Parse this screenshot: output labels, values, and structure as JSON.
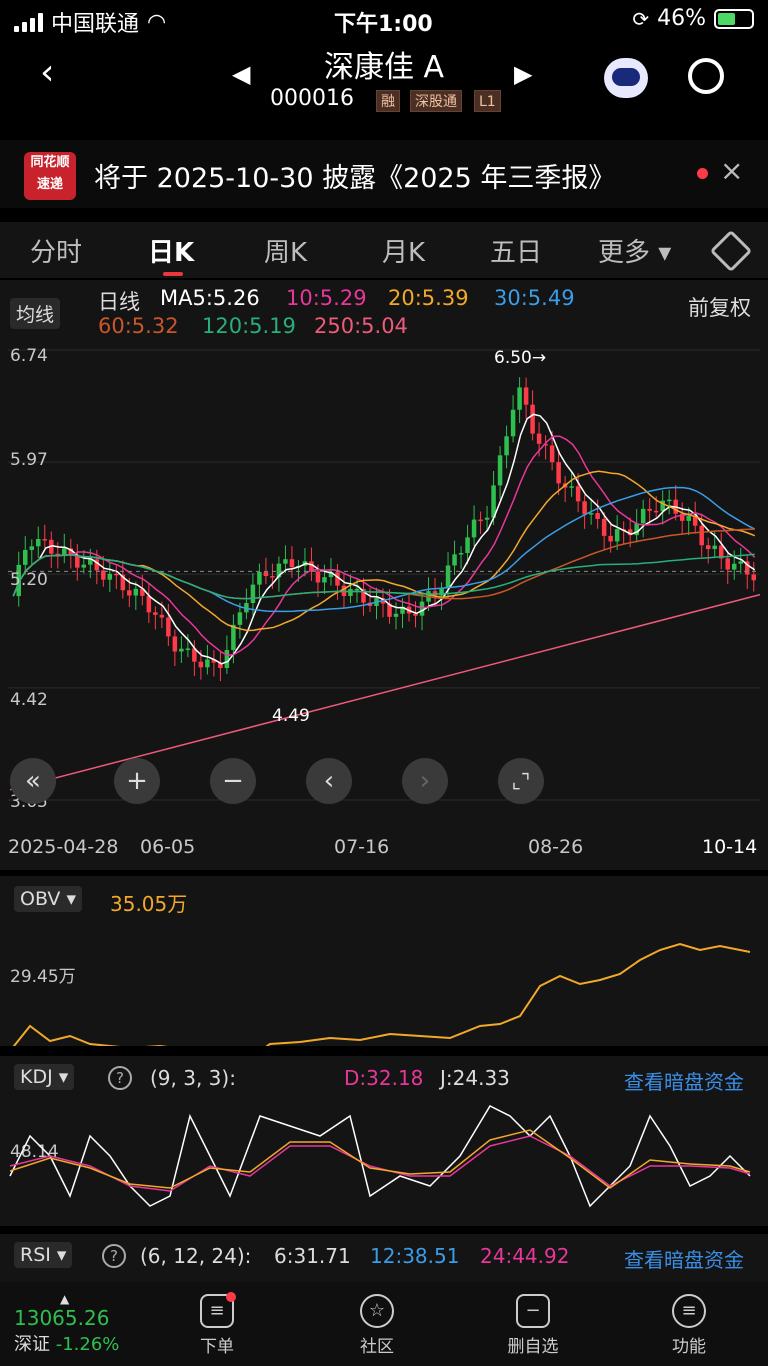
{
  "status_bar": {
    "carrier": "中国联通",
    "time": "下午1:00",
    "battery": "46%"
  },
  "header": {
    "title": "深康佳 A",
    "code": "000016",
    "tags": [
      "融",
      "深股通",
      "L1"
    ]
  },
  "banner": {
    "logo_line1": "同花顺",
    "logo_line2": "速递",
    "text": "将于 2025-10-30 披露《2025 年三季报》"
  },
  "tabs": [
    "分时",
    "日K",
    "周K",
    "月K",
    "五日",
    "更多"
  ],
  "ma_bar": {
    "chip": "均线",
    "kind": "日线",
    "fq": "前复权",
    "items": [
      {
        "label": "MA5:5.26",
        "color": "#ffffff"
      },
      {
        "label": "10:5.29",
        "color": "#e8379a"
      },
      {
        "label": "20:5.39",
        "color": "#f2a92a"
      },
      {
        "label": "30:5.49",
        "color": "#3a9de8"
      },
      {
        "label": "60:5.32",
        "color": "#c8572a"
      },
      {
        "label": "120:5.19",
        "color": "#27b07a"
      },
      {
        "label": "250:5.04",
        "color": "#ef5a7a"
      }
    ]
  },
  "kline": {
    "y_labels": [
      "6.74",
      "5.97",
      "5.20",
      "4.42",
      "3.65"
    ],
    "high_marker": "6.50→",
    "low_marker": "4.49",
    "x_labels": [
      "2025-04-28",
      "06-05",
      "07-16",
      "08-26",
      "10-14"
    ]
  },
  "obv": {
    "chip": "OBV",
    "value": "35.05万",
    "y_label": "29.45万"
  },
  "kdj": {
    "chip": "KDJ",
    "params": "(9, 3, 3):",
    "d": "D:32.18",
    "j": "J:24.33",
    "link": "查看暗盘资金",
    "y_label": "48.14"
  },
  "rsi": {
    "chip": "RSI",
    "params": "(6, 12, 24):",
    "r6": "6:31.71",
    "r12": "12:38.51",
    "r24": "24:44.92",
    "link": "查看暗盘资金"
  },
  "bottom_nav": {
    "index_value": "13065.26",
    "index_name": "深证",
    "index_change": "-1.26%",
    "items": [
      "下单",
      "社区",
      "删自选",
      "功能"
    ]
  },
  "colors": {
    "up": "#2fbf4f",
    "down": "#ff3b4a",
    "bg": "#141414"
  }
}
